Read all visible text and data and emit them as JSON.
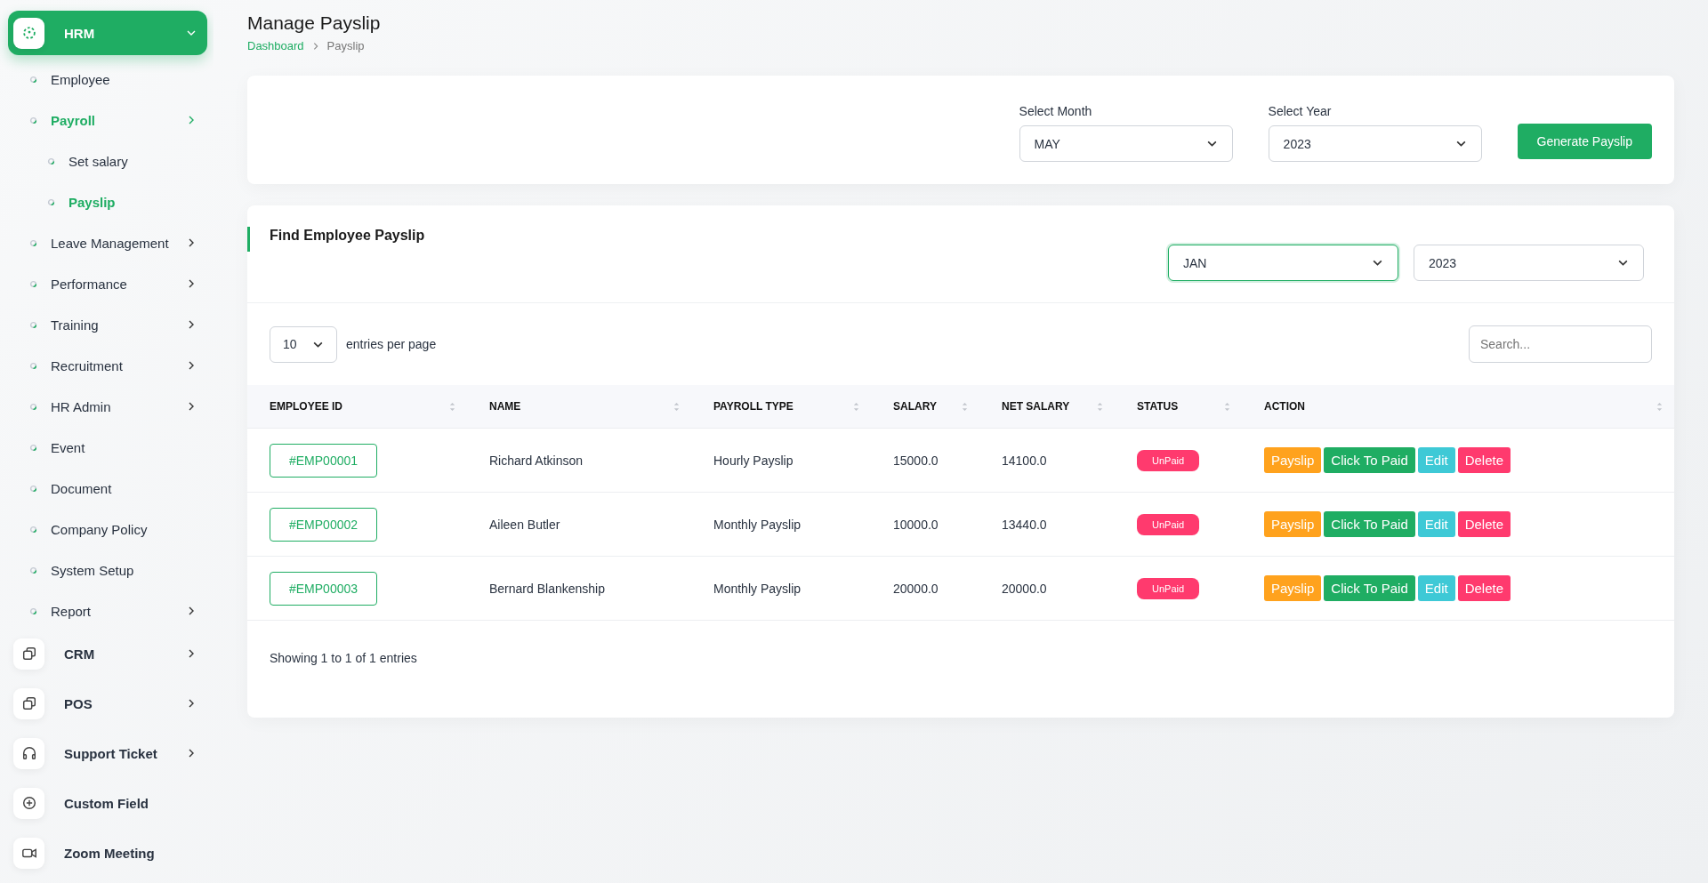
{
  "sidebar": {
    "modules": [
      {
        "kind": "hrm",
        "label": "HRM",
        "expanded": true,
        "expandable": true,
        "items": [
          {
            "label": "Employee",
            "selected": false,
            "expandable": false
          },
          {
            "label": "Payroll",
            "selected": true,
            "expandable": true,
            "children": [
              {
                "label": "Set salary",
                "selected": false
              },
              {
                "label": "Payslip",
                "selected": true
              }
            ]
          },
          {
            "label": "Leave Management",
            "selected": false,
            "expandable": true
          },
          {
            "label": "Performance",
            "selected": false,
            "expandable": true
          },
          {
            "label": "Training",
            "selected": false,
            "expandable": true
          },
          {
            "label": "Recruitment",
            "selected": false,
            "expandable": true
          },
          {
            "label": "HR Admin",
            "selected": false,
            "expandable": true
          },
          {
            "label": "Event",
            "selected": false,
            "expandable": false
          },
          {
            "label": "Document",
            "selected": false,
            "expandable": false
          },
          {
            "label": "Company Policy",
            "selected": false,
            "expandable": false
          },
          {
            "label": "System Setup",
            "selected": false,
            "expandable": false
          },
          {
            "label": "Report",
            "selected": false,
            "expandable": true
          }
        ]
      },
      {
        "kind": "crm",
        "label": "CRM",
        "expanded": false,
        "expandable": true
      },
      {
        "kind": "pos",
        "label": "POS",
        "expanded": false,
        "expandable": true
      },
      {
        "kind": "support",
        "label": "Support Ticket",
        "expanded": false,
        "expandable": true
      },
      {
        "kind": "custom",
        "label": "Custom Field",
        "expanded": false,
        "expandable": false
      },
      {
        "kind": "zoom",
        "label": "Zoom Meeting",
        "expanded": false,
        "expandable": false
      }
    ]
  },
  "page": {
    "title": "Manage Payslip",
    "breadcrumb": [
      {
        "label": "Dashboard",
        "link": true
      },
      {
        "label": "Payslip",
        "link": false
      }
    ]
  },
  "generate": {
    "month_label": "Select Month",
    "month": "MAY",
    "year_label": "Select Year",
    "year": "2023",
    "button": "Generate Payslip"
  },
  "find": {
    "title": "Find Employee Payslip",
    "filters": [
      {
        "value": "JAN",
        "focused": true
      },
      {
        "value": "2023",
        "focused": false
      }
    ],
    "per_page": "10",
    "per_page_label": "entries per page",
    "search_placeholder": "Search...",
    "table": {
      "columns": [
        "EMPLOYEE ID",
        "NAME",
        "PAYROLL TYPE",
        "SALARY",
        "NET SALARY",
        "STATUS",
        "ACTION"
      ],
      "rows": [
        {
          "id": "#EMP00001",
          "name": "Richard Atkinson",
          "type": "Hourly Payslip",
          "salary": "15000.0",
          "net": "14100.0",
          "status": {
            "label": "UnPaid",
            "color": "#ff3a6e"
          },
          "actions": [
            {
              "label": "Payslip",
              "color": "#ffa21d"
            },
            {
              "label": "Click To Paid",
              "color": "#1fad63"
            },
            {
              "label": "Edit",
              "color": "#3ec9d6"
            },
            {
              "label": "Delete",
              "color": "#ff3a6e"
            }
          ]
        },
        {
          "id": "#EMP00002",
          "name": "Aileen Butler",
          "type": "Monthly Payslip",
          "salary": "10000.0",
          "net": "13440.0",
          "status": {
            "label": "UnPaid",
            "color": "#ff3a6e"
          },
          "actions": [
            {
              "label": "Payslip",
              "color": "#ffa21d"
            },
            {
              "label": "Click To Paid",
              "color": "#1fad63"
            },
            {
              "label": "Edit",
              "color": "#3ec9d6"
            },
            {
              "label": "Delete",
              "color": "#ff3a6e"
            }
          ]
        },
        {
          "id": "#EMP00003",
          "name": "Bernard Blankenship",
          "type": "Monthly Payslip",
          "salary": "20000.0",
          "net": "20000.0",
          "status": {
            "label": "UnPaid",
            "color": "#ff3a6e"
          },
          "actions": [
            {
              "label": "Payslip",
              "color": "#ffa21d"
            },
            {
              "label": "Click To Paid",
              "color": "#1fad63"
            },
            {
              "label": "Edit",
              "color": "#3ec9d6"
            },
            {
              "label": "Delete",
              "color": "#ff3a6e"
            }
          ]
        }
      ]
    },
    "footer": "Showing 1 to 1 of 1 entries"
  }
}
